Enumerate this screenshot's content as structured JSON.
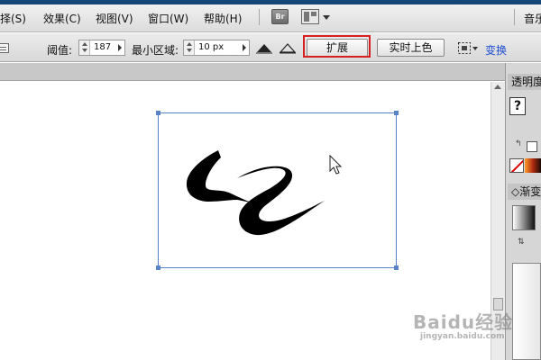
{
  "menubar": {
    "items": [
      {
        "label": "选择(S)",
        "display": "选择(S)"
      },
      {
        "label": "效果(C)"
      },
      {
        "label": "视图(V)"
      },
      {
        "label": "窗口(W)"
      },
      {
        "label": "帮助(H)"
      }
    ],
    "br_label": "Br",
    "right_label": "音乐"
  },
  "control_bar": {
    "threshold_label": "阈值:",
    "threshold_value": "187",
    "min_area_label": "最小区域:",
    "min_area_value": "10 px",
    "expand_button": "扩展",
    "live_color_button": "实时上色",
    "transform_link": "变换"
  },
  "panels": {
    "transparency_label": "透明度",
    "gradient_label": "渐变",
    "question_glyph": "?"
  },
  "watermark": {
    "main": "Baidu经验",
    "sub": "jingyan.baidu.com"
  },
  "colors": {
    "highlight": "#d62020",
    "selection": "#4a78c8",
    "link": "#1f4fd0",
    "top_strip": "#14467a"
  }
}
